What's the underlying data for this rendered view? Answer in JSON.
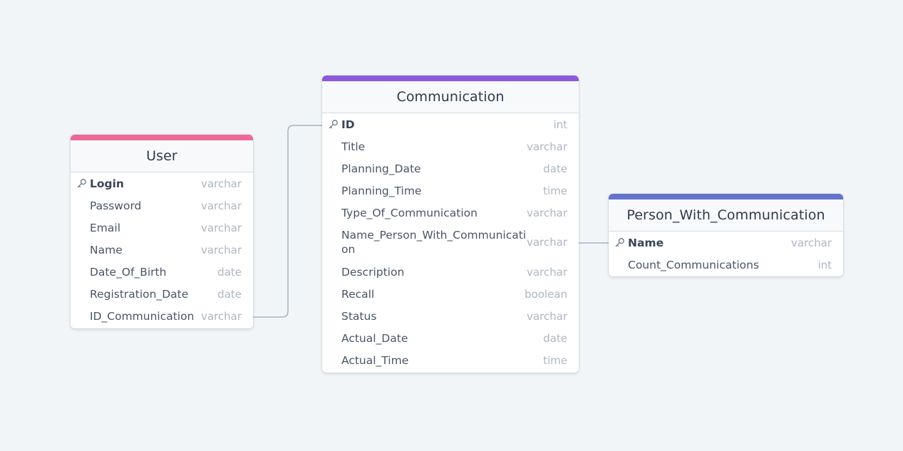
{
  "colors": {
    "background": "#f1f5f8",
    "connector": "#9aa8bd",
    "user_accent": "#ec6a96",
    "communication_accent": "#8d59d9",
    "person_accent": "#6474cc",
    "type_text": "#aeb6c2"
  },
  "tables": {
    "user": {
      "title": "User",
      "fields": [
        {
          "name": "Login",
          "type": "varchar",
          "pk": true,
          "icon": "key-icon"
        },
        {
          "name": "Password",
          "type": "varchar"
        },
        {
          "name": "Email",
          "type": "varchar"
        },
        {
          "name": "Name",
          "type": "varchar"
        },
        {
          "name": "Date_Of_Birth",
          "type": "date"
        },
        {
          "name": "Registration_Date",
          "type": "date"
        },
        {
          "name": "ID_Communication",
          "type": "varchar"
        }
      ]
    },
    "communication": {
      "title": "Communication",
      "fields": [
        {
          "name": "ID",
          "type": "int",
          "pk": true,
          "icon": "key-icon"
        },
        {
          "name": "Title",
          "type": "varchar"
        },
        {
          "name": "Planning_Date",
          "type": "date"
        },
        {
          "name": "Planning_Time",
          "type": "time"
        },
        {
          "name": "Type_Of_Communication",
          "type": "varchar"
        },
        {
          "name": "Name_Person_With_Communicati\non",
          "type": "varchar"
        },
        {
          "name": "Description",
          "type": "varchar"
        },
        {
          "name": "Recall",
          "type": "boolean"
        },
        {
          "name": "Status",
          "type": "varchar"
        },
        {
          "name": "Actual_Date",
          "type": "date"
        },
        {
          "name": "Actual_Time",
          "type": "time"
        }
      ]
    },
    "person_with_communication": {
      "title": "Person_With_Communication",
      "fields": [
        {
          "name": "Name",
          "type": "varchar",
          "pk": true,
          "icon": "key-icon"
        },
        {
          "name": "Count_Communications",
          "type": "int"
        }
      ]
    }
  }
}
